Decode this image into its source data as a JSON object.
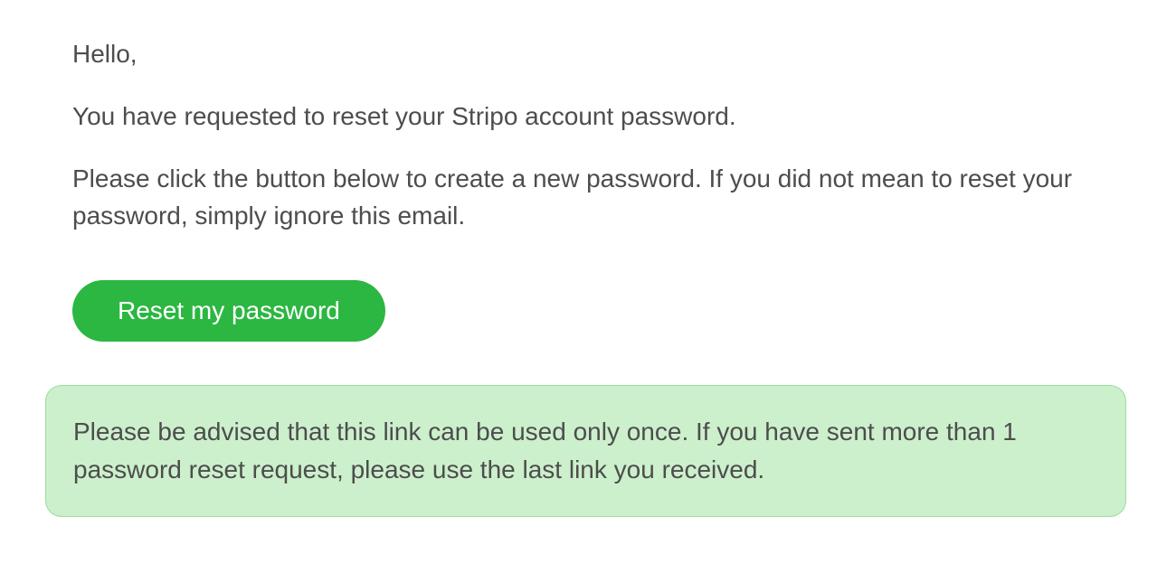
{
  "email": {
    "greeting": "Hello,",
    "intro": "You have requested to reset your Stripo account password.",
    "instructions": "Please click the button below to create a new password. If you did not mean to reset your password, simply ignore this email.",
    "button_label": "Reset my password",
    "notice": "Please be advised that this link can be used only once. If you have sent more than 1 password reset request, please use the last link you received."
  }
}
